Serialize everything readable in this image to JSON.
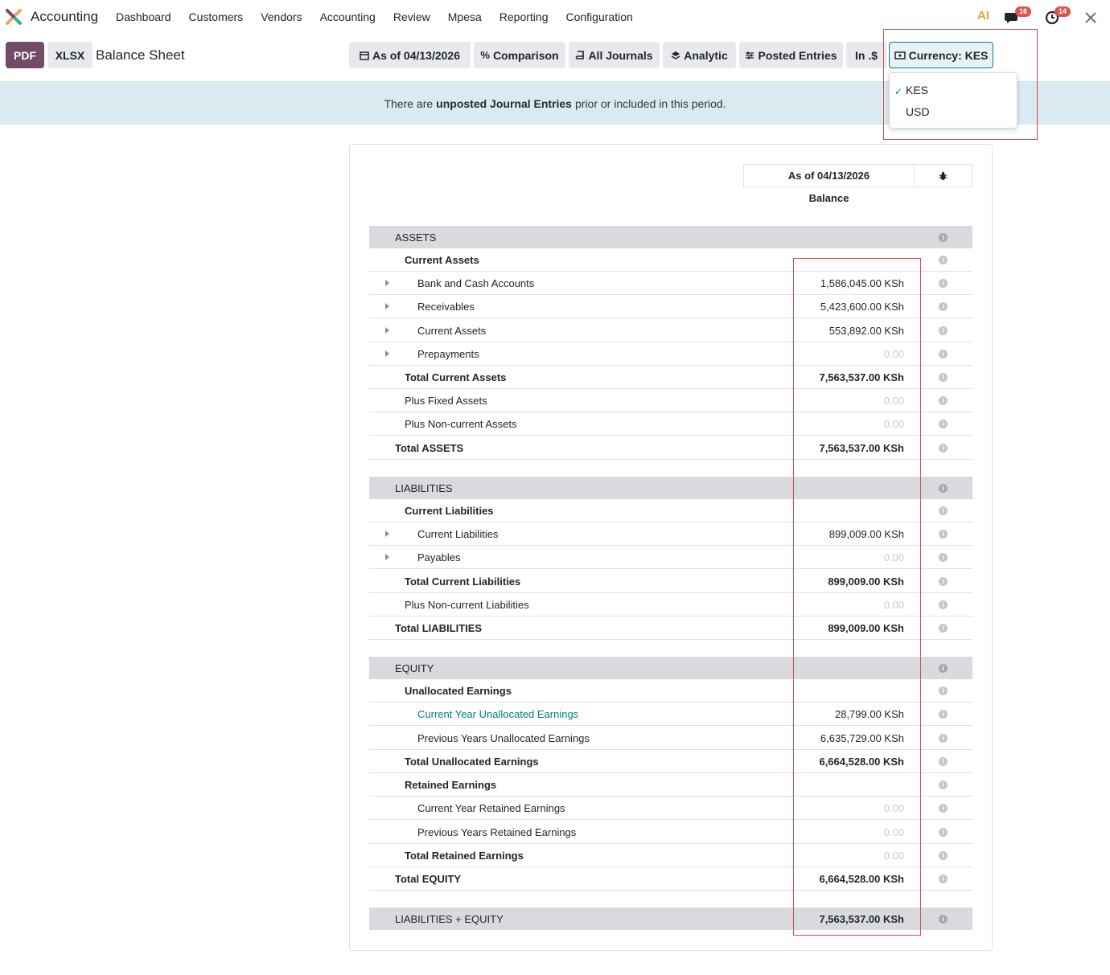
{
  "navbar": {
    "app_name": "Accounting",
    "menu": [
      "Dashboard",
      "Customers",
      "Vendors",
      "Accounting",
      "Review",
      "Mpesa",
      "Reporting",
      "Configuration"
    ],
    "ai_label": "AI",
    "messages_count": "16",
    "activities_count": "14"
  },
  "controls": {
    "pdf": "PDF",
    "xlsx": "XLSX",
    "title": "Balance Sheet",
    "filters": {
      "date": "As of 04/13/2026",
      "comparison": "Comparison",
      "journals": "All Journals",
      "analytic": "Analytic",
      "posted": "Posted Entries",
      "in": "In .$",
      "currency": "Currency: KES"
    }
  },
  "alert": {
    "prefix": "There are",
    "bold": "unposted Journal Entries",
    "suffix": "prior or included in this period."
  },
  "currency_dropdown": {
    "options": [
      "KES",
      "USD"
    ],
    "selected": "KES"
  },
  "report": {
    "column_header": "As of 04/13/2026",
    "column_sub": "Balance",
    "rows": [
      {
        "label": "ASSETS",
        "value": "",
        "type": "section"
      },
      {
        "label": "Current Assets",
        "value": "",
        "type": "group"
      },
      {
        "label": "Bank and Cash Accounts",
        "value": "1,586,045.00 KSh",
        "type": "line"
      },
      {
        "label": "Receivables",
        "value": "5,423,600.00 KSh",
        "type": "line"
      },
      {
        "label": "Current Assets",
        "value": "553,892.00 KSh",
        "type": "line"
      },
      {
        "label": "Prepayments",
        "value": "0.00",
        "type": "line-zero"
      },
      {
        "label": "Total Current Assets",
        "value": "7,563,537.00 KSh",
        "type": "total-group"
      },
      {
        "label": "Plus Fixed Assets",
        "value": "0.00",
        "type": "plain-zero"
      },
      {
        "label": "Plus Non-current Assets",
        "value": "0.00",
        "type": "plain-zero"
      },
      {
        "label": "Total ASSETS",
        "value": "7,563,537.00 KSh",
        "type": "total"
      },
      {
        "label": "LIABILITIES",
        "value": "",
        "type": "section"
      },
      {
        "label": "Current Liabilities",
        "value": "",
        "type": "group"
      },
      {
        "label": "Current Liabilities",
        "value": "899,009.00 KSh",
        "type": "line"
      },
      {
        "label": "Payables",
        "value": "0.00",
        "type": "line-zero"
      },
      {
        "label": "Total Current Liabilities",
        "value": "899,009.00 KSh",
        "type": "total-group"
      },
      {
        "label": "Plus Non-current Liabilities",
        "value": "0.00",
        "type": "plain-zero"
      },
      {
        "label": "Total LIABILITIES",
        "value": "899,009.00 KSh",
        "type": "total"
      },
      {
        "label": "EQUITY",
        "value": "",
        "type": "section"
      },
      {
        "label": "Unallocated Earnings",
        "value": "",
        "type": "group"
      },
      {
        "label": "Current Year Unallocated Earnings",
        "value": "28,799.00 KSh",
        "type": "line-link"
      },
      {
        "label": "Previous Years Unallocated Earnings",
        "value": "6,635,729.00 KSh",
        "type": "line-nocaret"
      },
      {
        "label": "Total Unallocated Earnings",
        "value": "6,664,528.00 KSh",
        "type": "total-group"
      },
      {
        "label": "Retained Earnings",
        "value": "",
        "type": "group"
      },
      {
        "label": "Current Year Retained Earnings",
        "value": "0.00",
        "type": "line-nocaret-zero"
      },
      {
        "label": "Previous Years Retained Earnings",
        "value": "0.00",
        "type": "line-nocaret-zero"
      },
      {
        "label": "Total Retained Earnings",
        "value": "0.00",
        "type": "total-group-zero"
      },
      {
        "label": "Total EQUITY",
        "value": "6,664,528.00 KSh",
        "type": "total"
      },
      {
        "label": "LIABILITIES + EQUITY",
        "value": "7,563,537.00 KSh",
        "type": "section-total"
      }
    ]
  }
}
